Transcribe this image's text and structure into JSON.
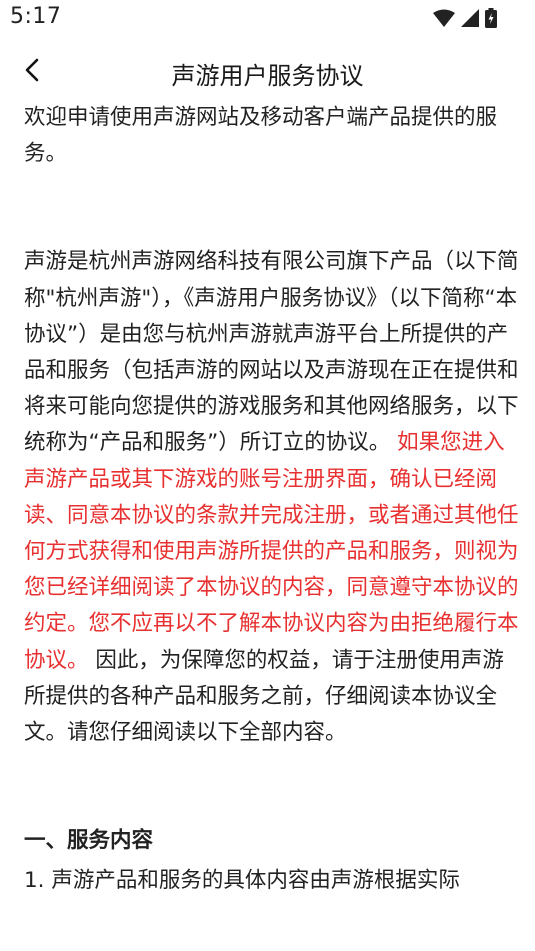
{
  "status_bar": {
    "time": "5:17"
  },
  "app_bar": {
    "title": "声游用户服务协议"
  },
  "content": {
    "intro": "欢迎申请使用声游网站及移动客户端产品提供的服务。",
    "para2_normal_1": "声游是杭州声游网络科技有限公司旗下产品（以下简称\"杭州声游\"），《声游用户服务协议》（以下简称“本协议”）是由您与杭州声游就声游平台上所提供的产品和服务（包括声游的网站以及声游现在正在提供和将来可能向您提供的游戏服务和其他网络服务，以下统称为“产品和服务”）所订立的协议。",
    "para2_red": " 如果您进入声游产品或其下游戏的账号注册界面，确认已经阅读、同意本协议的条款并完成注册，或者通过其他任何方式获得和使用声游所提供的产品和服务，则视为您已经详细阅读了本协议的内容，同意遵守本协议的约定。您不应再以不了解本协议内容为由拒绝履行本协议。",
    "para2_normal_2": " 因此，为保障您的权益，请于注册使用声游所提供的各种产品和服务之前，仔细阅读本协议全文。请您仔细阅读以下全部内容。",
    "section1_heading": "一、服务内容",
    "section1_item1": "1. 声游产品和服务的具体内容由声游根据实际"
  },
  "colors": {
    "warning_text": "#e83030",
    "body_text": "#222222"
  }
}
